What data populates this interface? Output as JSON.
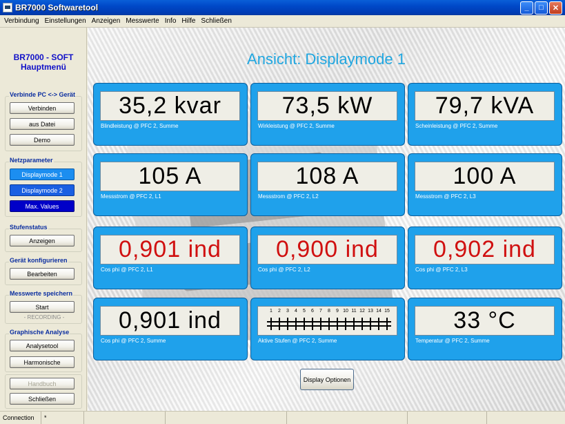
{
  "window": {
    "title": "BR7000 Softwaretool",
    "controls": [
      "_",
      "□",
      "✕"
    ]
  },
  "menu": [
    "Verbindung",
    "Einstellungen",
    "Anzeigen",
    "Messwerte",
    "Info",
    "Hilfe",
    "Schließen"
  ],
  "sidebar": {
    "app_title_line1": "BR7000 - SOFT",
    "app_title_line2": "Hauptmenü",
    "groups": [
      {
        "label": "Verbinde PC <-> Gerät",
        "buttons": [
          "Verbinden",
          "aus Datei",
          "Demo"
        ]
      },
      {
        "label": "Netzparameter",
        "buttons": [
          "Displaymode 1",
          "Displaymode 2",
          "Max. Values"
        ]
      },
      {
        "label": "Stufenstatus",
        "buttons": [
          "Anzeigen"
        ]
      },
      {
        "label": "Gerät konfigurieren",
        "buttons": [
          "Bearbeiten"
        ]
      },
      {
        "label": "Messwerte speichern",
        "buttons": [
          "Start"
        ],
        "status": "- RECORDING -"
      },
      {
        "label": "Graphische Analyse",
        "buttons": [
          "Analysetool",
          "Harmonische"
        ]
      }
    ],
    "bottom_buttons": [
      "Handbuch",
      "Schließen"
    ]
  },
  "main": {
    "title": "Ansicht: Displaymode 1",
    "tiles": [
      {
        "value": "35,2 kvar",
        "caption": "Blindleistung @ PFC 2, Summe"
      },
      {
        "value": "73,5 kW",
        "caption": "Wirkleistung @ PFC 2, Summe"
      },
      {
        "value": "79,7 kVA",
        "caption": "Scheinleistung @ PFC 2, Summe"
      },
      {
        "value": "105 A",
        "caption": "Messstrom @ PFC 2, L1"
      },
      {
        "value": "108 A",
        "caption": "Messstrom @ PFC 2, L2"
      },
      {
        "value": "100 A",
        "caption": "Messstrom @ PFC 2, L3"
      },
      {
        "value": "0,901 ind",
        "caption": "Cos phi @ PFC 2, L1"
      },
      {
        "value": "0,900 ind",
        "caption": "Cos phi @ PFC 2, L2"
      },
      {
        "value": "0,902 ind",
        "caption": "Cos phi @ PFC 2, L3"
      },
      {
        "value": "0,901 ind",
        "caption": "Cos phi @ PFC 2, Summe"
      },
      {
        "caption": "Aktive Stufen @ PFC 2, Summe",
        "stages": [
          "1",
          "2",
          "3",
          "4",
          "5",
          "6",
          "7",
          "8",
          "9",
          "10",
          "11",
          "12",
          "13",
          "14",
          "15"
        ]
      },
      {
        "value": "33 °C",
        "caption": "Temperatur @ PFC 2, Summe"
      }
    ],
    "options_button": "Display Optionen"
  },
  "statusbar": {
    "connection": "Connection",
    "indicator": "*"
  },
  "colors": {
    "tile": "#1fa1eb",
    "value_red": "#d01010",
    "title": "#1fa6e0"
  }
}
